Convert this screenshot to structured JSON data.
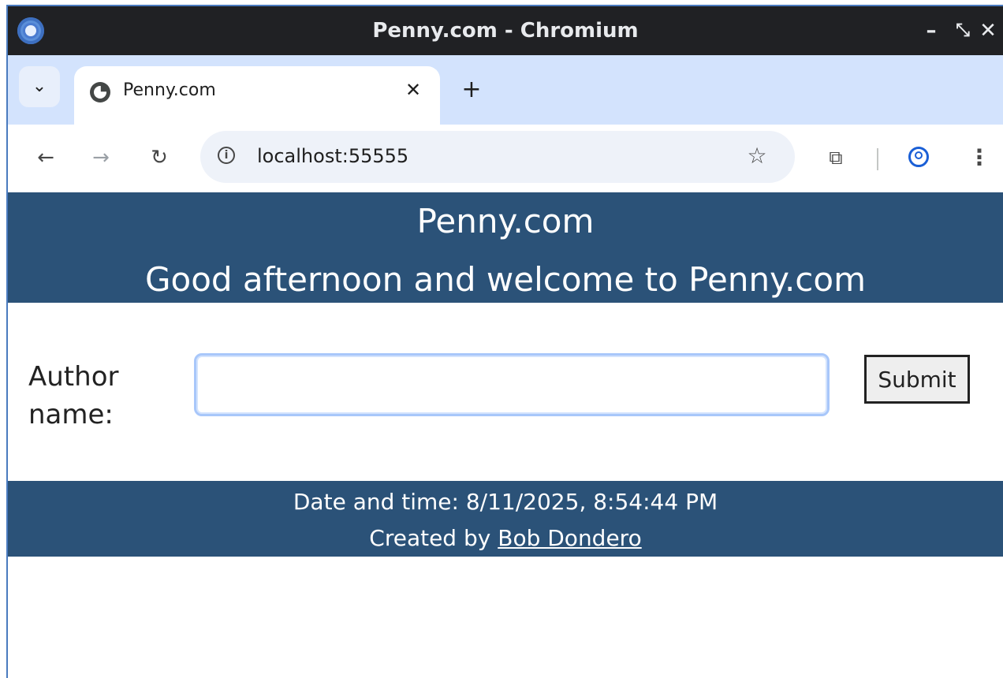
{
  "window": {
    "title": "Penny.com - Chromium",
    "controls": {
      "minimize": "–",
      "maximize": "⤡",
      "close": "✕"
    }
  },
  "tabs": [
    {
      "title": "Penny.com",
      "favicon": "globe-icon",
      "active": true
    }
  ],
  "toolbar": {
    "url": "localhost:55555"
  },
  "page": {
    "header_title": "Penny.com",
    "header_subtitle": "Good afternoon and welcome to Penny.com",
    "form": {
      "label": "Author name:",
      "input_value": "",
      "submit_label": "Submit"
    },
    "footer": {
      "datetime": "Date and time: 8/11/2025, 8:54:44 PM",
      "credit_prefix": "Created by",
      "credit_name": "Bob Dondero"
    }
  },
  "colors": {
    "banner": "#2b5278",
    "tabstrip": "#d3e3fd",
    "titlebar": "#202124"
  }
}
